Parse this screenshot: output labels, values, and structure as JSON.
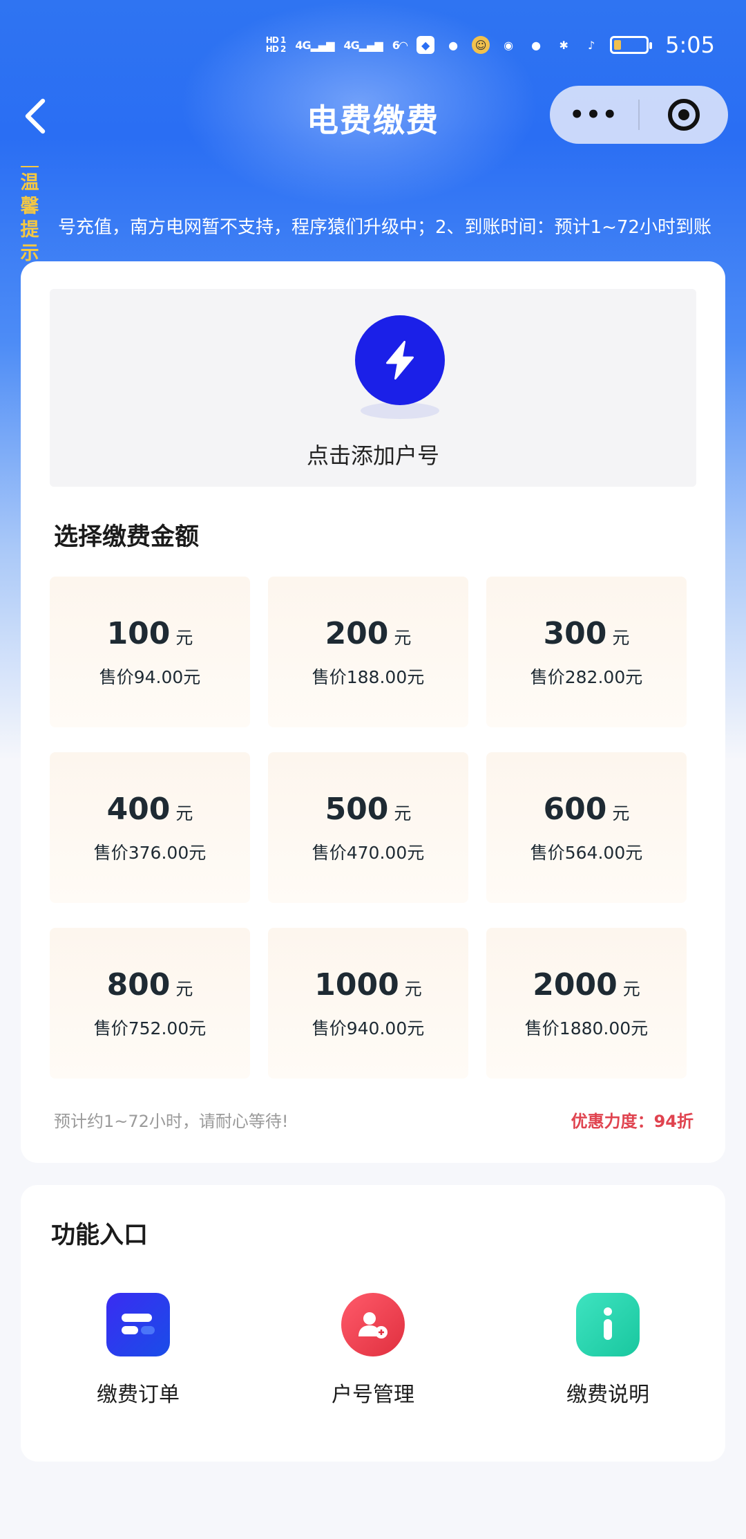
{
  "status_bar": {
    "hd1": "HD 1",
    "hd2": "HD 2",
    "sig1": "4G",
    "sig2": "4G",
    "sig3": "6",
    "time": "5:05"
  },
  "nav": {
    "title": "电费缴费",
    "more_glyph": "•••"
  },
  "notice": {
    "label": "温馨提示",
    "text": "号充值，南方电网暂不支持，程序猿们升级中；2、到账时间：预计1~72小时到账"
  },
  "add_account": {
    "text": "点击添加户号",
    "icon": "lightning-icon"
  },
  "amount_section": {
    "title": "选择缴费金额",
    "unit": "元",
    "items": [
      {
        "value": "100",
        "price": "售价94.00元"
      },
      {
        "value": "200",
        "price": "售价188.00元"
      },
      {
        "value": "300",
        "price": "售价282.00元"
      },
      {
        "value": "400",
        "price": "售价376.00元"
      },
      {
        "value": "500",
        "price": "售价470.00元"
      },
      {
        "value": "600",
        "price": "售价564.00元"
      },
      {
        "value": "800",
        "price": "售价752.00元"
      },
      {
        "value": "1000",
        "price": "售价940.00元"
      },
      {
        "value": "2000",
        "price": "售价1880.00元"
      }
    ],
    "hint": "预计约1~72小时，请耐心等待!",
    "discount": "优惠力度：94折"
  },
  "functions": {
    "title": "功能入口",
    "items": [
      {
        "label": "缴费订单",
        "icon": "order-icon"
      },
      {
        "label": "户号管理",
        "icon": "user-manage-icon"
      },
      {
        "label": "缴费说明",
        "icon": "info-icon"
      }
    ]
  },
  "colors": {
    "brand_blue": "#2a6ef3",
    "lightning": "#1b20e8",
    "discount_red": "#e0434f",
    "notice_yellow": "#f5c842"
  }
}
